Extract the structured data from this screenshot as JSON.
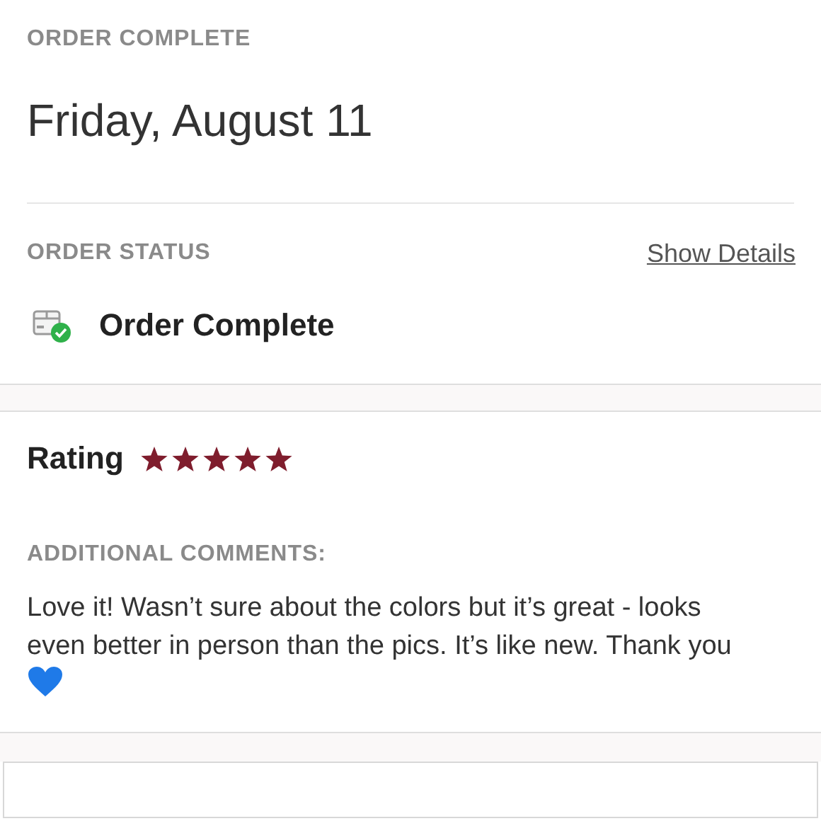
{
  "header": {
    "label": "ORDER COMPLETE",
    "date": "Friday, August 11"
  },
  "status": {
    "label": "ORDER STATUS",
    "link": "Show Details",
    "text": "Order Complete"
  },
  "rating": {
    "label": "Rating",
    "stars": 5
  },
  "comments": {
    "label": "ADDITIONAL COMMENTS:",
    "text": "Love it! Wasn’t sure about the colors but it’s great - looks even better in person than the pics. It’s like new. Thank you"
  }
}
